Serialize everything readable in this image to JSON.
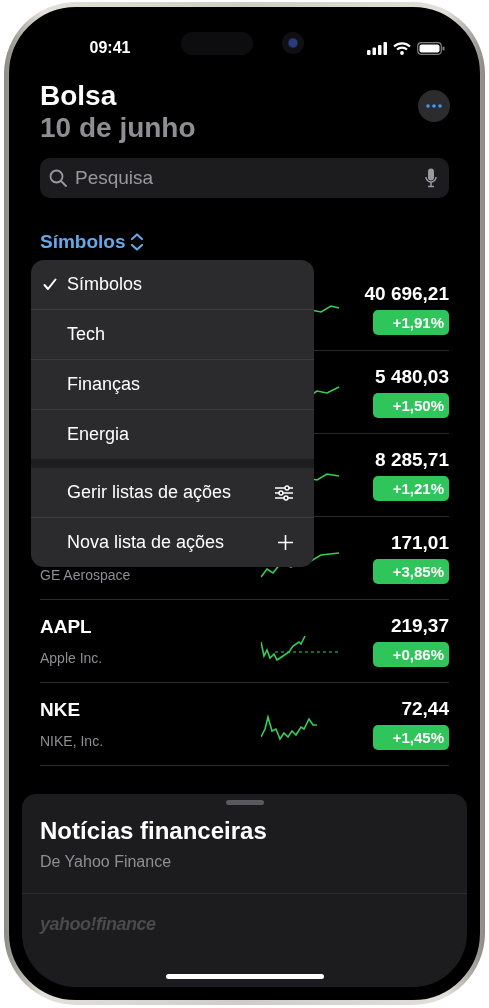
{
  "status_bar": {
    "time": "09:41"
  },
  "header": {
    "title": "Bolsa",
    "date": "10 de junho"
  },
  "search": {
    "placeholder": "Pesquisa"
  },
  "list_picker": {
    "label": "Símbolos",
    "expanded": true
  },
  "menu": {
    "lists": [
      {
        "label": "Símbolos",
        "selected": true
      },
      {
        "label": "Tech",
        "selected": false
      },
      {
        "label": "Finanças",
        "selected": false
      },
      {
        "label": "Energia",
        "selected": false
      }
    ],
    "actions": [
      {
        "label": "Gerir listas de ações",
        "kind": "manage"
      },
      {
        "label": "Nova lista de ações",
        "kind": "add"
      }
    ]
  },
  "stocks": [
    {
      "price": "40 696,21",
      "change": "+1,91%"
    },
    {
      "price": "5 480,03",
      "change": "+1,50%"
    },
    {
      "price": "8 285,71",
      "change": "+1,21%"
    },
    {
      "name": "GE Aerospace",
      "price": "171,01",
      "change": "+3,85%"
    },
    {
      "symbol": "AAPL",
      "name": "Apple Inc.",
      "price": "219,37",
      "change": "+0,86%"
    },
    {
      "symbol": "NKE",
      "name": "NIKE, Inc.",
      "price": "72,44",
      "change": "+1,45%"
    }
  ],
  "news_sheet": {
    "title": "Notícias financeiras",
    "subtitle": "De Yahoo Finance",
    "logo": "yahoo!finance"
  }
}
